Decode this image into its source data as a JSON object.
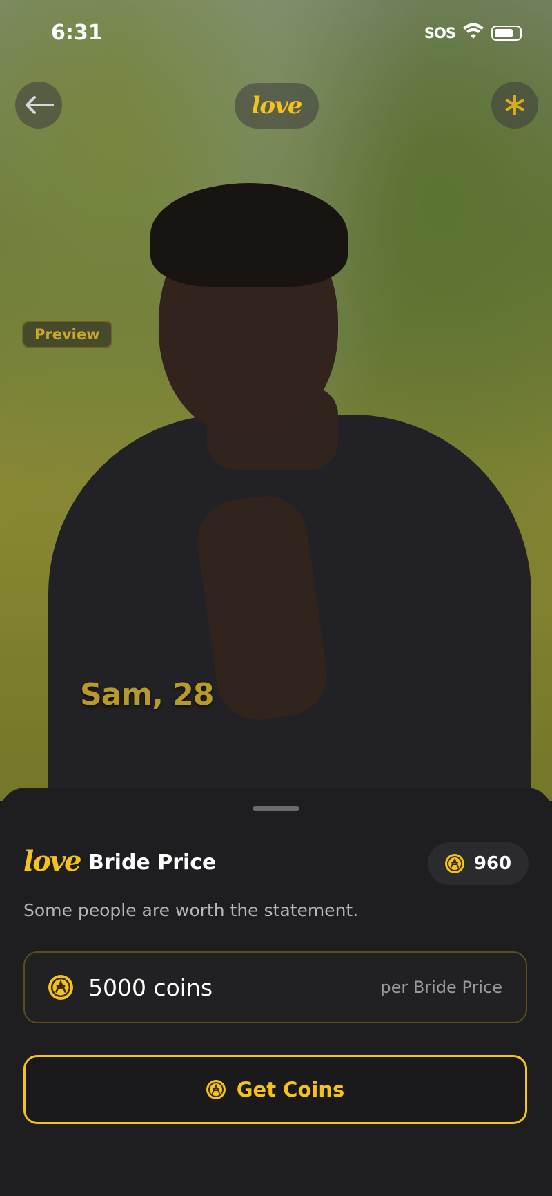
{
  "status_bar": {
    "time": "6:31",
    "sos": "SOS"
  },
  "header": {
    "logo": "love"
  },
  "profile": {
    "badge": "Preview",
    "name_age": "Sam, 28"
  },
  "sheet": {
    "logo": "love",
    "title": "Bride Price",
    "balance": "960",
    "subtitle": "Some people are worth the statement.",
    "price_amount": "5000 coins",
    "price_unit": "per Bride Price",
    "button_label": "Get Coins"
  },
  "colors": {
    "accent": "#f5c21b",
    "sheet_bg": "#1e1e21"
  }
}
